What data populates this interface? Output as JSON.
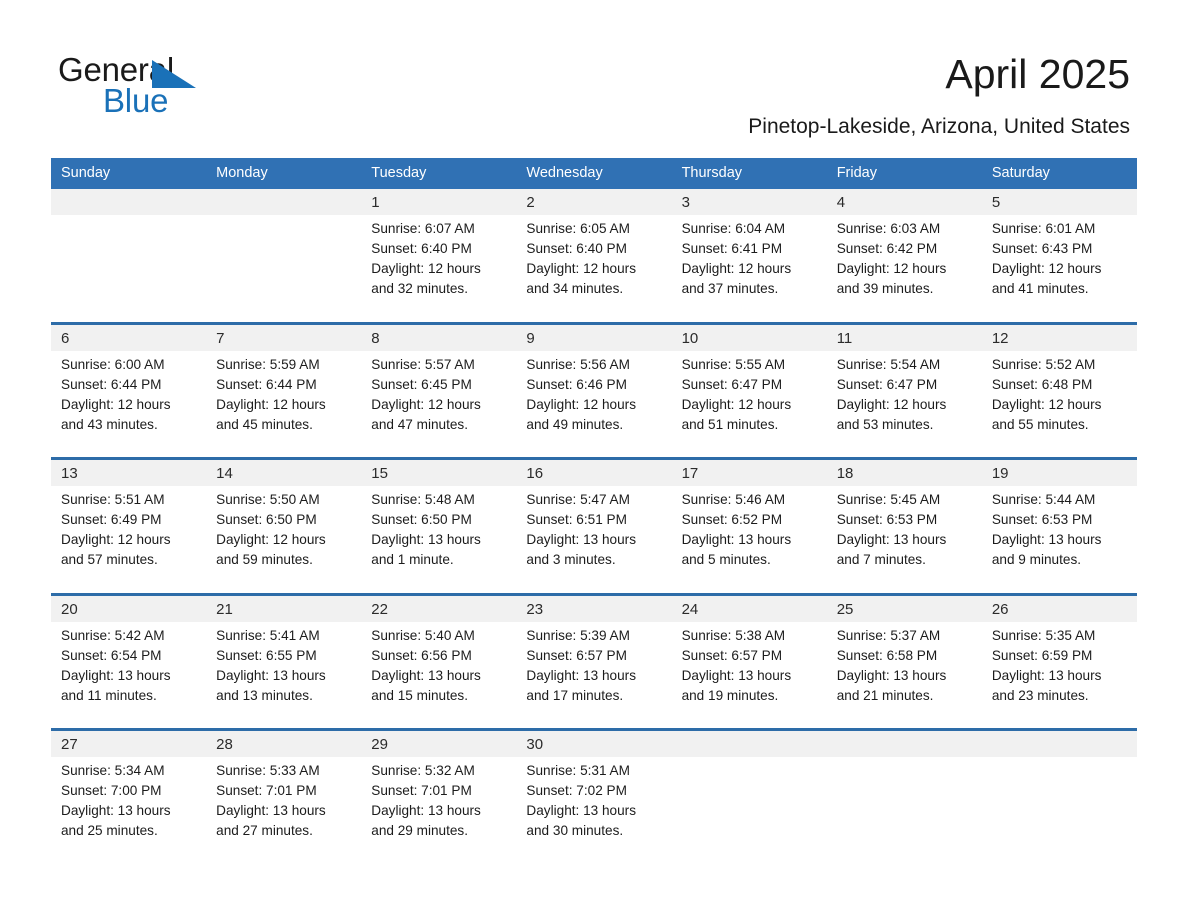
{
  "brand": {
    "name_part1": "General",
    "name_part2": "Blue",
    "triangle_color": "#1a71b8"
  },
  "header": {
    "title": "April 2025",
    "subtitle": "Pinetop-Lakeside, Arizona, United States"
  },
  "theme": {
    "header_blue": "#3071b4",
    "rule_blue": "#2d6ca8",
    "daynum_band": "#f1f1f1",
    "text": "#1c1c1c"
  },
  "weekdays": [
    "Sunday",
    "Monday",
    "Tuesday",
    "Wednesday",
    "Thursday",
    "Friday",
    "Saturday"
  ],
  "weeks": [
    {
      "days": [
        {
          "num": "",
          "lines": []
        },
        {
          "num": "",
          "lines": []
        },
        {
          "num": "1",
          "lines": [
            "Sunrise: 6:07 AM",
            "Sunset: 6:40 PM",
            "Daylight: 12 hours",
            "and 32 minutes."
          ]
        },
        {
          "num": "2",
          "lines": [
            "Sunrise: 6:05 AM",
            "Sunset: 6:40 PM",
            "Daylight: 12 hours",
            "and 34 minutes."
          ]
        },
        {
          "num": "3",
          "lines": [
            "Sunrise: 6:04 AM",
            "Sunset: 6:41 PM",
            "Daylight: 12 hours",
            "and 37 minutes."
          ]
        },
        {
          "num": "4",
          "lines": [
            "Sunrise: 6:03 AM",
            "Sunset: 6:42 PM",
            "Daylight: 12 hours",
            "and 39 minutes."
          ]
        },
        {
          "num": "5",
          "lines": [
            "Sunrise: 6:01 AM",
            "Sunset: 6:43 PM",
            "Daylight: 12 hours",
            "and 41 minutes."
          ]
        }
      ]
    },
    {
      "days": [
        {
          "num": "6",
          "lines": [
            "Sunrise: 6:00 AM",
            "Sunset: 6:44 PM",
            "Daylight: 12 hours",
            "and 43 minutes."
          ]
        },
        {
          "num": "7",
          "lines": [
            "Sunrise: 5:59 AM",
            "Sunset: 6:44 PM",
            "Daylight: 12 hours",
            "and 45 minutes."
          ]
        },
        {
          "num": "8",
          "lines": [
            "Sunrise: 5:57 AM",
            "Sunset: 6:45 PM",
            "Daylight: 12 hours",
            "and 47 minutes."
          ]
        },
        {
          "num": "9",
          "lines": [
            "Sunrise: 5:56 AM",
            "Sunset: 6:46 PM",
            "Daylight: 12 hours",
            "and 49 minutes."
          ]
        },
        {
          "num": "10",
          "lines": [
            "Sunrise: 5:55 AM",
            "Sunset: 6:47 PM",
            "Daylight: 12 hours",
            "and 51 minutes."
          ]
        },
        {
          "num": "11",
          "lines": [
            "Sunrise: 5:54 AM",
            "Sunset: 6:47 PM",
            "Daylight: 12 hours",
            "and 53 minutes."
          ]
        },
        {
          "num": "12",
          "lines": [
            "Sunrise: 5:52 AM",
            "Sunset: 6:48 PM",
            "Daylight: 12 hours",
            "and 55 minutes."
          ]
        }
      ]
    },
    {
      "days": [
        {
          "num": "13",
          "lines": [
            "Sunrise: 5:51 AM",
            "Sunset: 6:49 PM",
            "Daylight: 12 hours",
            "and 57 minutes."
          ]
        },
        {
          "num": "14",
          "lines": [
            "Sunrise: 5:50 AM",
            "Sunset: 6:50 PM",
            "Daylight: 12 hours",
            "and 59 minutes."
          ]
        },
        {
          "num": "15",
          "lines": [
            "Sunrise: 5:48 AM",
            "Sunset: 6:50 PM",
            "Daylight: 13 hours",
            "and 1 minute."
          ]
        },
        {
          "num": "16",
          "lines": [
            "Sunrise: 5:47 AM",
            "Sunset: 6:51 PM",
            "Daylight: 13 hours",
            "and 3 minutes."
          ]
        },
        {
          "num": "17",
          "lines": [
            "Sunrise: 5:46 AM",
            "Sunset: 6:52 PM",
            "Daylight: 13 hours",
            "and 5 minutes."
          ]
        },
        {
          "num": "18",
          "lines": [
            "Sunrise: 5:45 AM",
            "Sunset: 6:53 PM",
            "Daylight: 13 hours",
            "and 7 minutes."
          ]
        },
        {
          "num": "19",
          "lines": [
            "Sunrise: 5:44 AM",
            "Sunset: 6:53 PM",
            "Daylight: 13 hours",
            "and 9 minutes."
          ]
        }
      ]
    },
    {
      "days": [
        {
          "num": "20",
          "lines": [
            "Sunrise: 5:42 AM",
            "Sunset: 6:54 PM",
            "Daylight: 13 hours",
            "and 11 minutes."
          ]
        },
        {
          "num": "21",
          "lines": [
            "Sunrise: 5:41 AM",
            "Sunset: 6:55 PM",
            "Daylight: 13 hours",
            "and 13 minutes."
          ]
        },
        {
          "num": "22",
          "lines": [
            "Sunrise: 5:40 AM",
            "Sunset: 6:56 PM",
            "Daylight: 13 hours",
            "and 15 minutes."
          ]
        },
        {
          "num": "23",
          "lines": [
            "Sunrise: 5:39 AM",
            "Sunset: 6:57 PM",
            "Daylight: 13 hours",
            "and 17 minutes."
          ]
        },
        {
          "num": "24",
          "lines": [
            "Sunrise: 5:38 AM",
            "Sunset: 6:57 PM",
            "Daylight: 13 hours",
            "and 19 minutes."
          ]
        },
        {
          "num": "25",
          "lines": [
            "Sunrise: 5:37 AM",
            "Sunset: 6:58 PM",
            "Daylight: 13 hours",
            "and 21 minutes."
          ]
        },
        {
          "num": "26",
          "lines": [
            "Sunrise: 5:35 AM",
            "Sunset: 6:59 PM",
            "Daylight: 13 hours",
            "and 23 minutes."
          ]
        }
      ]
    },
    {
      "days": [
        {
          "num": "27",
          "lines": [
            "Sunrise: 5:34 AM",
            "Sunset: 7:00 PM",
            "Daylight: 13 hours",
            "and 25 minutes."
          ]
        },
        {
          "num": "28",
          "lines": [
            "Sunrise: 5:33 AM",
            "Sunset: 7:01 PM",
            "Daylight: 13 hours",
            "and 27 minutes."
          ]
        },
        {
          "num": "29",
          "lines": [
            "Sunrise: 5:32 AM",
            "Sunset: 7:01 PM",
            "Daylight: 13 hours",
            "and 29 minutes."
          ]
        },
        {
          "num": "30",
          "lines": [
            "Sunrise: 5:31 AM",
            "Sunset: 7:02 PM",
            "Daylight: 13 hours",
            "and 30 minutes."
          ]
        },
        {
          "num": "",
          "lines": []
        },
        {
          "num": "",
          "lines": []
        },
        {
          "num": "",
          "lines": []
        }
      ]
    }
  ]
}
